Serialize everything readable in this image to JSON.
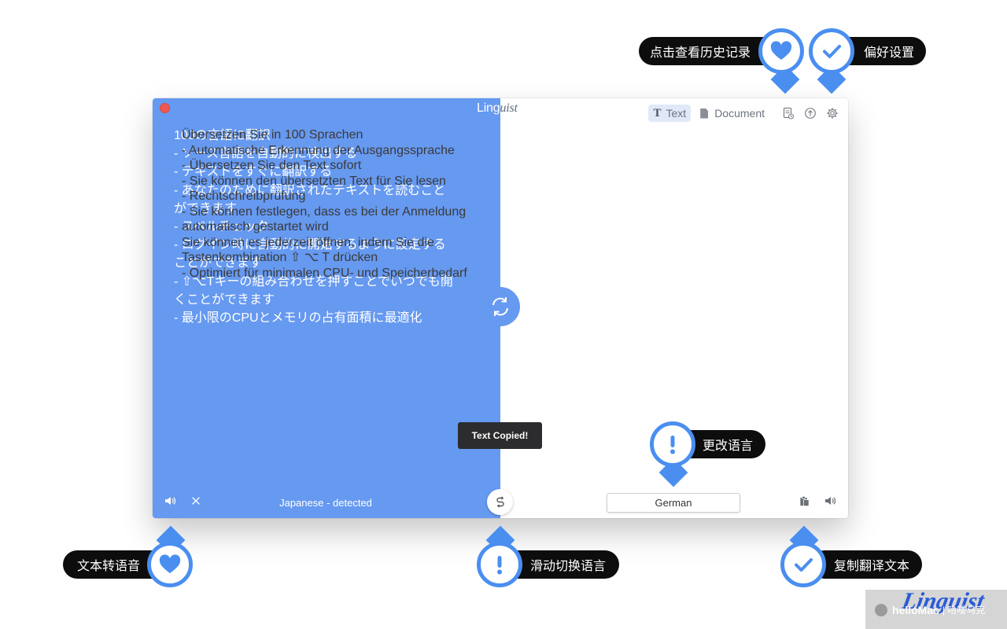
{
  "window": {
    "title_main": "Ling",
    "title_script": "uist"
  },
  "toolbar": {
    "text_tab_glyph": "T",
    "text_tab_label": "Text",
    "document_tab_label": "Document",
    "history_icon": "history-icon",
    "share_icon": "share-up-icon",
    "settings_icon": "gear-icon"
  },
  "source": {
    "text": "100の言語に翻訳\n- ソース言語を自動的に検出する\n- テキストをすぐに翻訳する\n- あなたのために翻訳されたテキストを読むこと\nができます\n- スペルチェック\n- ログイン時に自動的に開始するように設定する\nことができます\n- ⇧⌥Tキーの組み合わせを押すことでいつでも開\nくことができます\n- 最小限のCPUとメモリの占有面積に最適化",
    "language_label": "Japanese - detected"
  },
  "target": {
    "text": "Übersetzen Sie in 100 Sprachen\n- Automatische Erkennung der Ausgangssprache\n- Übersetzen Sie den Text sofort\n- Sie können den übersetzten Text für Sie lesen\n- Rechtschreibprüfung\n- Sie können festlegen, dass es bei der Anmeldung\nautomatisch gestartet wird\nSie können es jederzeit öffnen, indem Sie die\nTastenkombination ⇧ ⌥ T drücken\n- Optimiert für minimalen CPU- und Speicherbedarf",
    "language_label": "German"
  },
  "toast": {
    "text": "Text Copied!"
  },
  "callouts": {
    "history": "点击查看历史记录",
    "preferences": "偏好设置",
    "change_language": "更改语言",
    "text_to_speech": "文本转语音",
    "swipe_switch": "滑动切换语言",
    "copy_translation": "复制翻译文本"
  },
  "branding": {
    "logo_script": "Linguist",
    "site": "helloMac",
    "site_sub": "| 哈喽马克"
  },
  "colors": {
    "accent": "#6699f0",
    "callout_blue": "#4a8ef0",
    "close_red": "#f0574f"
  }
}
